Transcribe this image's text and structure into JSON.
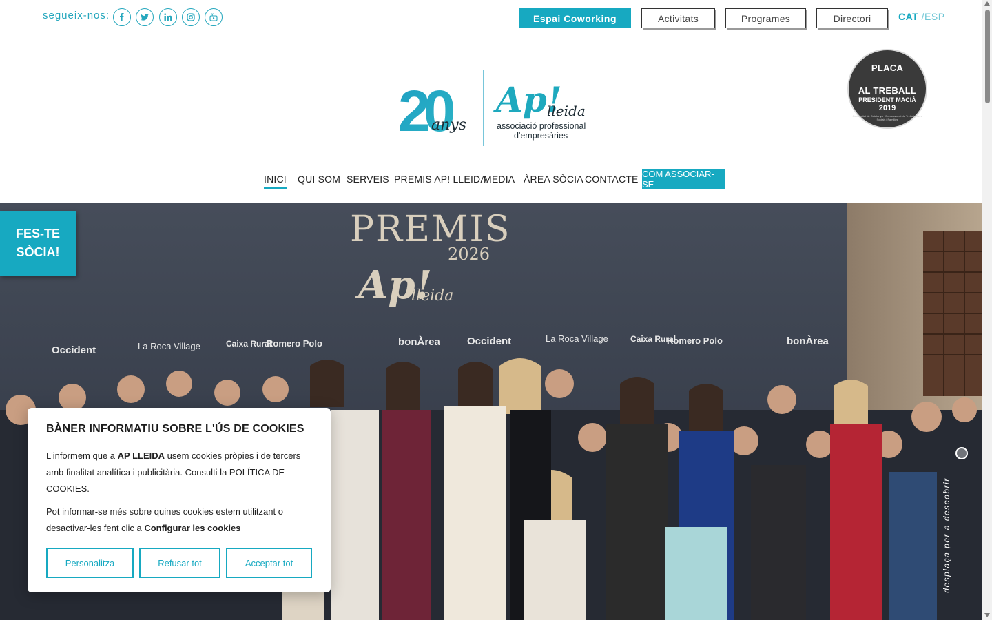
{
  "topbar": {
    "follow_label": "segueix-nos:",
    "social_icons": [
      "facebook-icon",
      "twitter-icon",
      "linkedin-icon",
      "instagram-icon",
      "youtube-icon"
    ],
    "cowork_label": "Espai Coworking",
    "activitats_label": "Activitats",
    "programes_label": "Programes",
    "directori_label": "Directori",
    "lang_cat": "CAT",
    "lang_sep": " /",
    "lang_esp": "ESP"
  },
  "logo": {
    "anniversary": "20",
    "anys": "anys",
    "brand": "Ap!",
    "city": "lleida",
    "tagline_1": "associació professional",
    "tagline_2": "d'empresàries"
  },
  "seal": {
    "line1": "PLACA",
    "line2": "AL TREBALL",
    "line3": "PRESIDENT MACIÀ",
    "year": "2019",
    "small": "Generalitat de Catalunya · Departament de Treball, Afers Socials i Famílies"
  },
  "nav": {
    "items": [
      "INICI",
      "QUI SOM",
      "SERVEIS",
      "PREMIS AP! LLEIDA",
      "MEDIA",
      "ÀREA SÒCIA",
      "CONTACTE"
    ],
    "cta": "COM ASSOCIAR-SE"
  },
  "hero": {
    "banner_title": "PREMIS",
    "banner_brand": "Ap!",
    "banner_city": "lleida",
    "banner_year": "2026",
    "sponsors": [
      "Occident",
      "La Roca Village",
      "Caixa Rural",
      "Romero Polo",
      "bonÀrea"
    ],
    "fes_line1": "FES-TE",
    "fes_line2": "SÒCIA!",
    "scroll_hint": "desplaça per a descobrir"
  },
  "cookie": {
    "title": "BÀNER INFORMATIU SOBRE L'ÚS DE COOKIES",
    "p1_a": "L'informem que a ",
    "p1_b": "AP LLEIDA",
    "p1_c": " usem cookies pròpies i de tercers amb finalitat analítica i publicitària. Consulti la POLÍTICA DE COOKIES.",
    "p2_a": "Pot informar-se més sobre quines cookies estem utilitzant o desactivar-les fent clic a ",
    "p2_b": "Configurar les cookies",
    "btn_custom": "Personalitza",
    "btn_reject": "Refusar tot",
    "btn_accept": "Acceptar tot"
  },
  "colors": {
    "accent": "#17a9c1",
    "text": "#222222",
    "seal_bg": "#3a3a3a"
  }
}
